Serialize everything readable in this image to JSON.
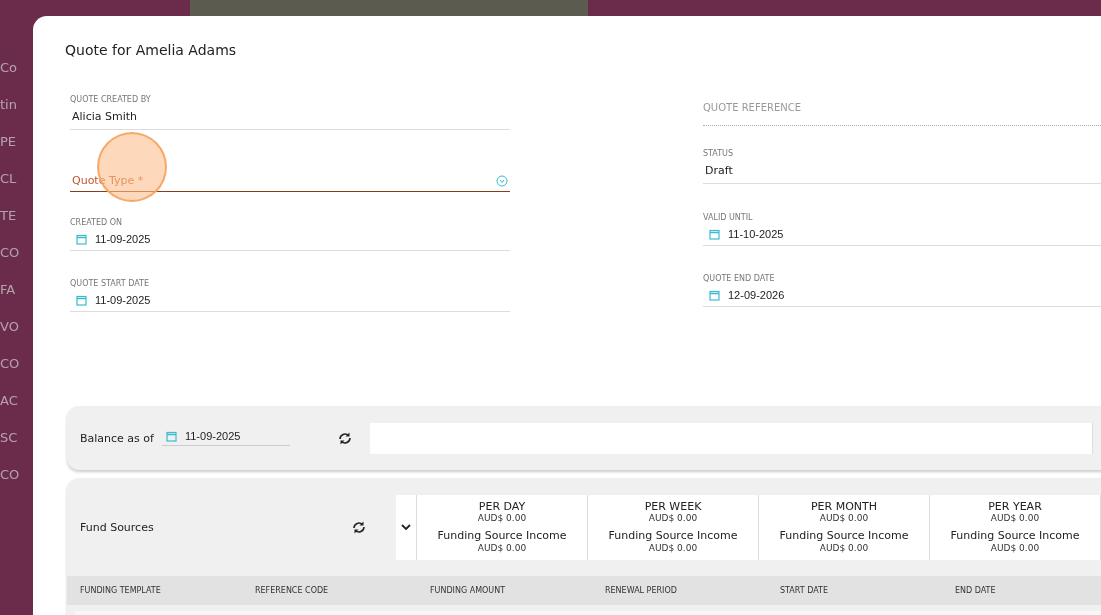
{
  "background": {
    "sidebar_items": [
      "Co",
      "tin",
      "PE",
      "CL",
      "TE",
      "CO",
      "FA",
      "VO",
      "CO",
      "AC",
      "SC",
      "CO"
    ]
  },
  "modal": {
    "title": "Quote for Amelia Adams",
    "left_fields": [
      {
        "kind": "text",
        "label": "QUOTE CREATED BY",
        "value": "Alicia Smith"
      },
      {
        "kind": "select",
        "placeholder": "Quote Type *",
        "invalid": true
      },
      {
        "kind": "date",
        "label": "CREATED ON",
        "value": "11-09-2025"
      },
      {
        "kind": "date",
        "label": "QUOTE START DATE",
        "value": "11-09-2025"
      }
    ],
    "right_fields": [
      {
        "kind": "readonly",
        "placeholder": "QUOTE REFERENCE"
      },
      {
        "kind": "text",
        "label": "STATUS",
        "value": "Draft"
      },
      {
        "kind": "date",
        "label": "VALID UNTIL",
        "value": "11-10-2025"
      },
      {
        "kind": "date",
        "label": "QUOTE END DATE",
        "value": "12-09-2026"
      }
    ],
    "balance": {
      "label": "Balance as of",
      "date": "11-09-2025"
    },
    "fund_sources": {
      "title": "Fund Sources",
      "periods": [
        {
          "name": "PER DAY",
          "amount": "AUD$ 0.00",
          "income_label": "Funding Source Income",
          "income": "AUD$ 0.00"
        },
        {
          "name": "PER WEEK",
          "amount": "AUD$ 0.00",
          "income_label": "Funding Source Income",
          "income": "AUD$ 0.00"
        },
        {
          "name": "PER MONTH",
          "amount": "AUD$ 0.00",
          "income_label": "Funding Source Income",
          "income": "AUD$ 0.00"
        },
        {
          "name": "PER YEAR",
          "amount": "AUD$ 0.00",
          "income_label": "Funding Source Income",
          "income": "AUD$ 0.00"
        }
      ],
      "columns": [
        "FUNDING TEMPLATE",
        "REFERENCE CODE",
        "FUNDING AMOUNT",
        "RENEWAL PERIOD",
        "START DATE",
        "END DATE"
      ]
    }
  }
}
